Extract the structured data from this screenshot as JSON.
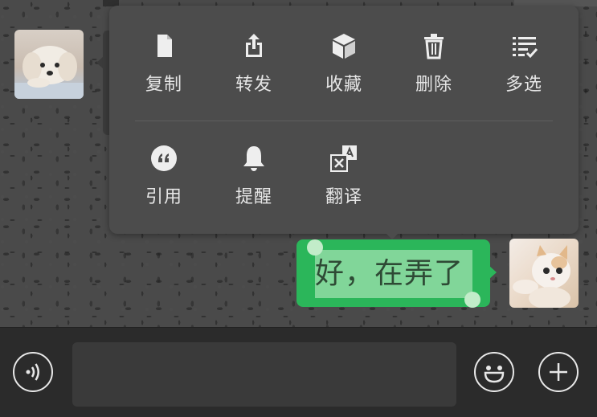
{
  "context_menu": {
    "items": [
      {
        "label": "复制",
        "icon": "document-icon"
      },
      {
        "label": "转发",
        "icon": "share-icon"
      },
      {
        "label": "收藏",
        "icon": "cube-icon"
      },
      {
        "label": "删除",
        "icon": "trash-icon"
      },
      {
        "label": "多选",
        "icon": "multi-select-icon"
      },
      {
        "label": "引用",
        "icon": "quote-icon"
      },
      {
        "label": "提醒",
        "icon": "bell-icon"
      },
      {
        "label": "翻译",
        "icon": "translate-icon"
      }
    ]
  },
  "message": {
    "text": "好，在弄了",
    "bubble_color": "#2bb65a",
    "selected": true
  },
  "input_bar": {
    "input_value": "",
    "voice_icon": "voice-icon",
    "emoji_icon": "emoji-icon",
    "add_icon": "plus-icon"
  },
  "colors": {
    "menu_bg": "#4c4c4c",
    "menu_text": "#e6e6e6",
    "input_bar_bg": "#2b2b2b"
  }
}
